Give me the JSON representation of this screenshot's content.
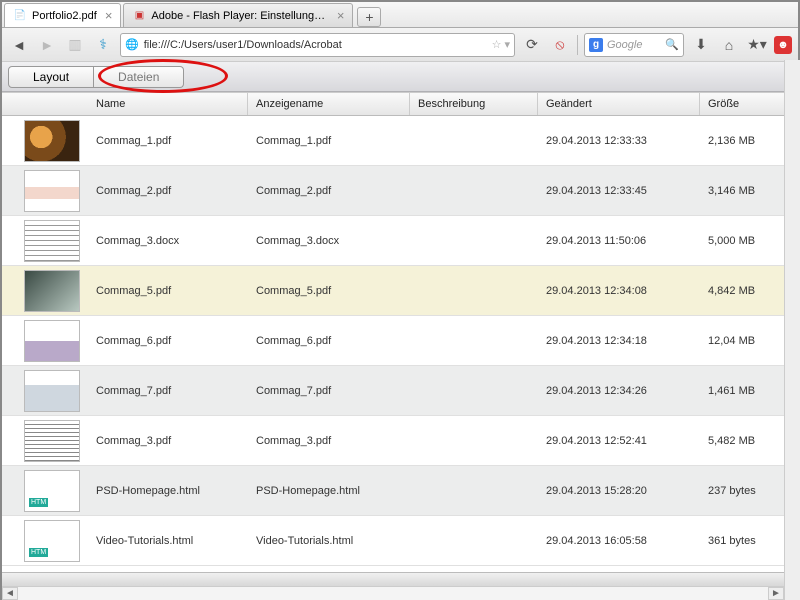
{
  "browser": {
    "tabs": [
      {
        "title": "Portfolio2.pdf",
        "active": true
      },
      {
        "title": "Adobe - Flash Player: Einstellungsma...",
        "active": false
      }
    ],
    "url": "file:///C:/Users/user1/Downloads/Acrobat",
    "search_placeholder": "Google"
  },
  "app": {
    "tabs": {
      "layout": "Layout",
      "files": "Dateien"
    }
  },
  "columns": {
    "name": "Name",
    "display": "Anzeigename",
    "desc": "Beschreibung",
    "modified": "Geändert",
    "size": "Größe"
  },
  "rows": [
    {
      "name": "Commag_1.pdf",
      "display": "Commag_1.pdf",
      "desc": "",
      "modified": "29.04.2013 12:33:33",
      "size": "2,136 MB",
      "thumb": "t-lion"
    },
    {
      "name": "Commag_2.pdf",
      "display": "Commag_2.pdf",
      "desc": "",
      "modified": "29.04.2013 12:33:45",
      "size": "3,146 MB",
      "thumb": "t-photo"
    },
    {
      "name": "Commag_3.docx",
      "display": "Commag_3.docx",
      "desc": "",
      "modified": "29.04.2013 11:50:06",
      "size": "5,000 MB",
      "thumb": "t-doc"
    },
    {
      "name": "Commag_5.pdf",
      "display": "Commag_5.pdf",
      "desc": "",
      "modified": "29.04.2013 12:34:08",
      "size": "4,842 MB",
      "thumb": "t-dark",
      "selected": true
    },
    {
      "name": "Commag_6.pdf",
      "display": "Commag_6.pdf",
      "desc": "",
      "modified": "29.04.2013 12:34:18",
      "size": "12,04 MB",
      "thumb": "t-pg"
    },
    {
      "name": "Commag_7.pdf",
      "display": "Commag_7.pdf",
      "desc": "",
      "modified": "29.04.2013 12:34:26",
      "size": "1,461 MB",
      "thumb": "t-pg2"
    },
    {
      "name": "Commag_3.pdf",
      "display": "Commag_3.pdf",
      "desc": "",
      "modified": "29.04.2013 12:52:41",
      "size": "5,482 MB",
      "thumb": "t-news"
    },
    {
      "name": "PSD-Homepage.html",
      "display": "PSD-Homepage.html",
      "desc": "",
      "modified": "29.04.2013 15:28:20",
      "size": "237 bytes",
      "thumb": "t-htm"
    },
    {
      "name": "Video-Tutorials.html",
      "display": "Video-Tutorials.html",
      "desc": "",
      "modified": "29.04.2013 16:05:58",
      "size": "361 bytes",
      "thumb": "t-htm"
    }
  ]
}
